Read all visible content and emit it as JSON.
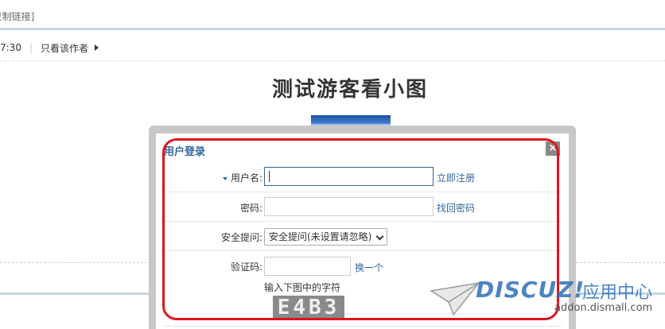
{
  "thread": {
    "copy_link": "[复制链接]",
    "time": "7:30",
    "only_author": "只看该作者",
    "title": "测试游客看小图"
  },
  "login_dialog": {
    "title": "用户登录",
    "close": "×",
    "username_label": "用户名:",
    "username_value": "",
    "register_link": "立即注册",
    "password_label": "密码:",
    "password_value": "",
    "find_password_link": "找回密码",
    "question_label": "安全提问:",
    "question_selected": "安全提问(未设置请忽略)",
    "captcha_label": "验证码:",
    "captcha_refresh": "换一个",
    "captcha_hint": "输入下图中的字符",
    "captcha_text": "E4B3"
  },
  "watermark": {
    "logo": "DISCUZ!",
    "cn": "应用中心",
    "url": "addon.dismall.com"
  },
  "colors": {
    "link": "#336699",
    "annotation": "#e0141e",
    "rule": "#c2d5e3"
  }
}
